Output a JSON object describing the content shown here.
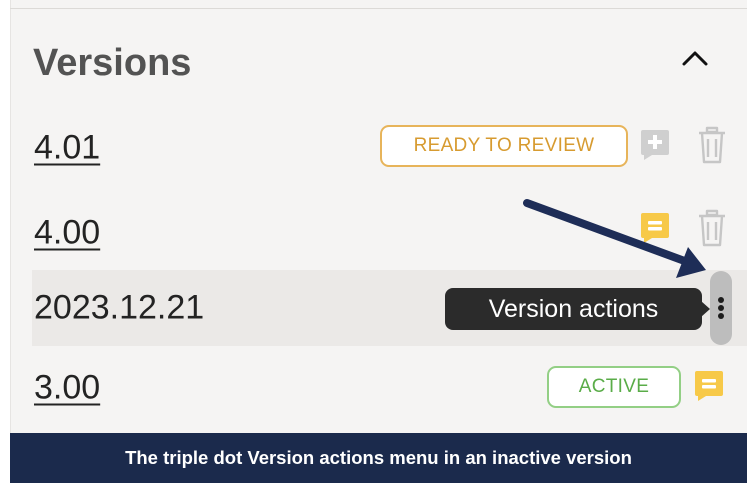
{
  "panel": {
    "title": "Versions",
    "versions": [
      {
        "label": "4.01",
        "status": "READY TO REVIEW"
      },
      {
        "label": "4.00"
      },
      {
        "label": "2023.12.21"
      },
      {
        "label": "3.00",
        "status": "ACTIVE"
      }
    ]
  },
  "tooltip": {
    "text": "Version actions"
  },
  "caption": {
    "text": "The triple dot Version actions menu in an inactive version"
  },
  "icons": {
    "collapse": "chevron-up-icon",
    "add_comment": "comment-plus-icon",
    "comment": "comment-icon",
    "delete": "trash-icon",
    "actions": "kebab-menu-icon"
  },
  "colors": {
    "review": "#e7b45a",
    "active": "#93cf85",
    "comment_yellow": "#f7c948",
    "caption_bg": "#1b2a4c",
    "annotation_arrow": "#1e2d57"
  }
}
